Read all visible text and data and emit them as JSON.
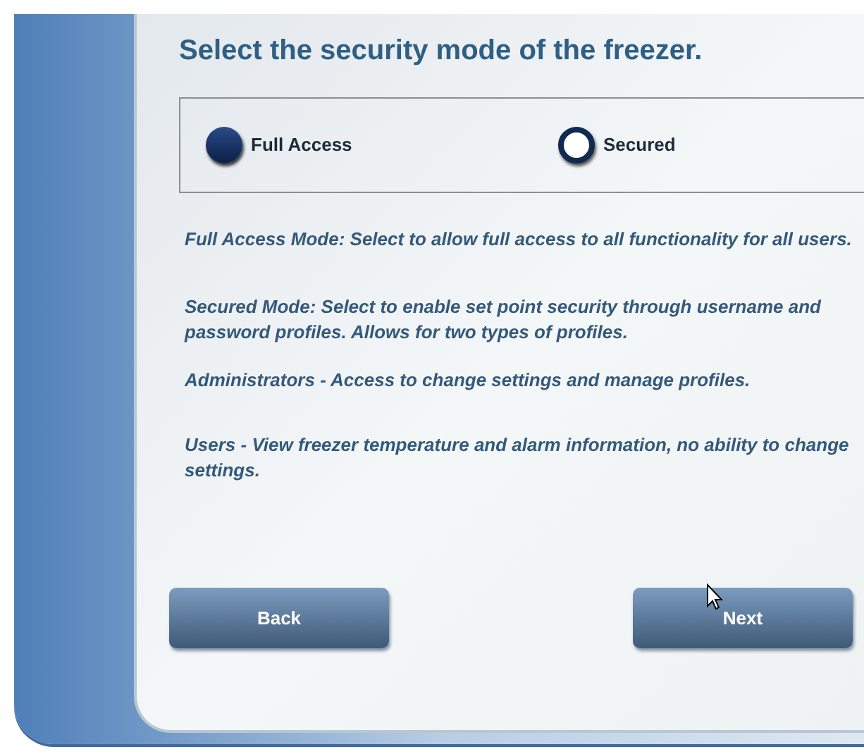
{
  "title": "Select the security mode of the freezer.",
  "modes": [
    {
      "label": "Full Access",
      "selected": true
    },
    {
      "label": "Secured",
      "selected": false
    }
  ],
  "descriptions": [
    "Full Access Mode: Select to allow full access to all functionality for all users.",
    "Secured Mode: Select to enable set point security through username and password profiles. Allows for two types of profiles.",
    "Administrators - Access to change settings and manage profiles.",
    "Users - View freezer temperature and alarm information, no ability to change settings."
  ],
  "buttons": [
    {
      "label": "Back",
      "kind": "back"
    },
    {
      "label": "Next",
      "kind": "next"
    }
  ]
}
